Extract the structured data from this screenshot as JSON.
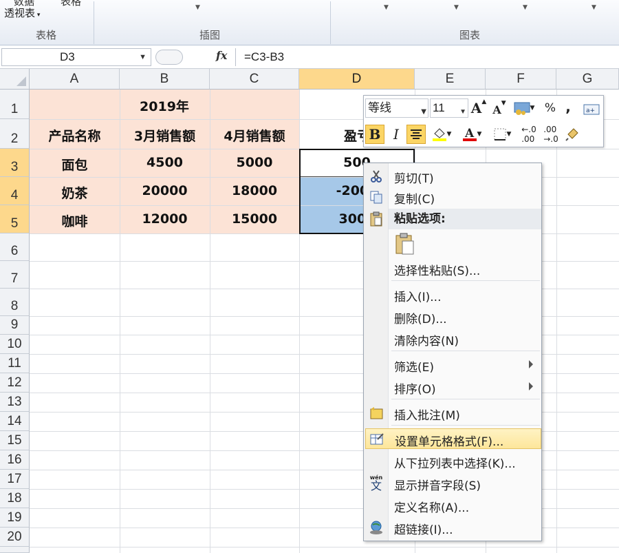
{
  "ribbon": {
    "top_left_button": "透视表",
    "groups": [
      {
        "label": "表格"
      },
      {
        "label": "插图"
      },
      {
        "label": "图表"
      }
    ]
  },
  "formula_bar": {
    "name_box": "D3",
    "fx_label": "fx",
    "formula": "=C3-B3"
  },
  "columns": [
    "A",
    "B",
    "C",
    "D",
    "E",
    "F",
    "G"
  ],
  "selected_column": "D",
  "rows": [
    "1",
    "2",
    "3",
    "4",
    "5",
    "6",
    "7",
    "8",
    "9",
    "10",
    "11",
    "12",
    "13",
    "14",
    "15",
    "16",
    "17",
    "18",
    "19",
    "20"
  ],
  "selected_rows": [
    "3",
    "4",
    "5"
  ],
  "sheet": {
    "title": "2019年",
    "headers": {
      "a": "产品名称",
      "b": "3月销售额",
      "c": "4月销售额",
      "d": "盈亏"
    },
    "data_rows": [
      {
        "a": "面包",
        "b": "4500",
        "c": "5000",
        "d": "500"
      },
      {
        "a": "奶茶",
        "b": "20000",
        "c": "18000",
        "d": "-2000"
      },
      {
        "a": "咖啡",
        "b": "12000",
        "c": "15000",
        "d": "3000"
      }
    ]
  },
  "mini_toolbar": {
    "font_name": "等线",
    "font_size": "11",
    "bold": "B",
    "italic": "I",
    "grow_font": "A",
    "shrink_font": "A",
    "percent": "%",
    "comma": ",",
    "font_color": "#e00000",
    "highlight_color": "#ffff00"
  },
  "context_menu": {
    "items": [
      {
        "label": "剪切(T)",
        "icon": "scissors-icon"
      },
      {
        "label": "复制(C)",
        "icon": "copy-icon"
      },
      {
        "label": "粘贴选项:",
        "icon": "paste-icon",
        "header": true
      },
      {
        "label": "选择性粘贴(S)...",
        "icon": ""
      },
      {
        "label": "插入(I)...",
        "icon": ""
      },
      {
        "label": "删除(D)...",
        "icon": ""
      },
      {
        "label": "清除内容(N)",
        "icon": ""
      },
      {
        "label": "筛选(E)",
        "icon": "",
        "submenu": true
      },
      {
        "label": "排序(O)",
        "icon": "",
        "submenu": true
      },
      {
        "label": "插入批注(M)",
        "icon": "comment-icon"
      },
      {
        "label": "设置单元格格式(F)...",
        "icon": "format-cells-icon",
        "highlighted": true
      },
      {
        "label": "从下拉列表中选择(K)...",
        "icon": ""
      },
      {
        "label": "显示拼音字段(S)",
        "icon": "pinyin-icon"
      },
      {
        "label": "定义名称(A)...",
        "icon": ""
      },
      {
        "label": "超链接(I)...",
        "icon": "hyperlink-icon"
      }
    ]
  },
  "colors": {
    "header_fill": "#fce3d6",
    "selection_fill": "#a6c8e8",
    "selected_header": "#fdd88c",
    "menu_highlight": "#fde69b"
  }
}
